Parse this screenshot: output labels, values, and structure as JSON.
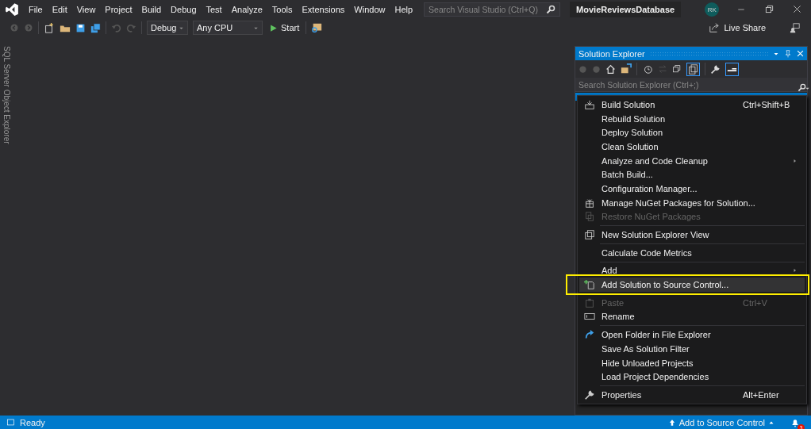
{
  "menu_bar": [
    "File",
    "Edit",
    "View",
    "Project",
    "Build",
    "Debug",
    "Test",
    "Analyze",
    "Tools",
    "Extensions",
    "Window",
    "Help"
  ],
  "search": {
    "placeholder": "Search Visual Studio (Ctrl+Q)"
  },
  "window": {
    "title": "MovieReviewsDatabase",
    "avatar": "RK"
  },
  "toolbar": {
    "configuration": "Debug",
    "platform": "Any CPU",
    "start": "Start",
    "live_share": "Live Share"
  },
  "side_tab": "SQL Server Object Explorer",
  "solution_explorer": {
    "title": "Solution Explorer",
    "search": {
      "placeholder": "Search Solution Explorer (Ctrl+;)"
    }
  },
  "context_menu": [
    {
      "kind": "item",
      "label": "Build Solution",
      "shortcut": "Ctrl+Shift+B",
      "disabled": false,
      "submenu": false,
      "highlighted": false
    },
    {
      "kind": "item",
      "label": "Rebuild Solution",
      "disabled": false,
      "submenu": false,
      "highlighted": false
    },
    {
      "kind": "item",
      "label": "Deploy Solution",
      "disabled": false,
      "submenu": false,
      "highlighted": false
    },
    {
      "kind": "item",
      "label": "Clean Solution",
      "disabled": false,
      "submenu": false,
      "highlighted": false
    },
    {
      "kind": "item",
      "label": "Analyze and Code Cleanup",
      "disabled": false,
      "submenu": true,
      "highlighted": false
    },
    {
      "kind": "item",
      "label": "Batch Build...",
      "disabled": false,
      "submenu": false,
      "highlighted": false
    },
    {
      "kind": "item",
      "label": "Configuration Manager...",
      "disabled": false,
      "submenu": false,
      "highlighted": false
    },
    {
      "kind": "item",
      "label": "Manage NuGet Packages for Solution...",
      "disabled": false,
      "submenu": false,
      "highlighted": false
    },
    {
      "kind": "item",
      "label": "Restore NuGet Packages",
      "disabled": true,
      "submenu": false,
      "highlighted": false
    },
    {
      "kind": "separator"
    },
    {
      "kind": "item",
      "label": "New Solution Explorer View",
      "disabled": false,
      "submenu": false,
      "highlighted": false
    },
    {
      "kind": "separator"
    },
    {
      "kind": "item",
      "label": "Calculate Code Metrics",
      "disabled": false,
      "submenu": false,
      "highlighted": false
    },
    {
      "kind": "separator"
    },
    {
      "kind": "item",
      "label": "Add",
      "disabled": false,
      "submenu": true,
      "highlighted": false
    },
    {
      "kind": "item",
      "label": "Add Solution to Source Control...",
      "disabled": false,
      "submenu": false,
      "highlighted": true
    },
    {
      "kind": "separator"
    },
    {
      "kind": "item",
      "label": "Paste",
      "shortcut": "Ctrl+V",
      "disabled": true,
      "submenu": false,
      "highlighted": false
    },
    {
      "kind": "item",
      "label": "Rename",
      "disabled": false,
      "submenu": false,
      "highlighted": false
    },
    {
      "kind": "separator"
    },
    {
      "kind": "item",
      "label": "Open Folder in File Explorer",
      "disabled": false,
      "submenu": false,
      "highlighted": false
    },
    {
      "kind": "item",
      "label": "Save As Solution Filter",
      "disabled": false,
      "submenu": false,
      "highlighted": false
    },
    {
      "kind": "item",
      "label": "Hide Unloaded Projects",
      "disabled": false,
      "submenu": false,
      "highlighted": false
    },
    {
      "kind": "item",
      "label": "Load Project Dependencies",
      "disabled": false,
      "submenu": false,
      "highlighted": false
    },
    {
      "kind": "separator"
    },
    {
      "kind": "item",
      "label": "Properties",
      "shortcut": "Alt+Enter",
      "disabled": false,
      "submenu": false,
      "highlighted": false
    }
  ],
  "status_bar": {
    "status": "Ready",
    "source_control": "Add to Source Control",
    "notifications": "3"
  }
}
